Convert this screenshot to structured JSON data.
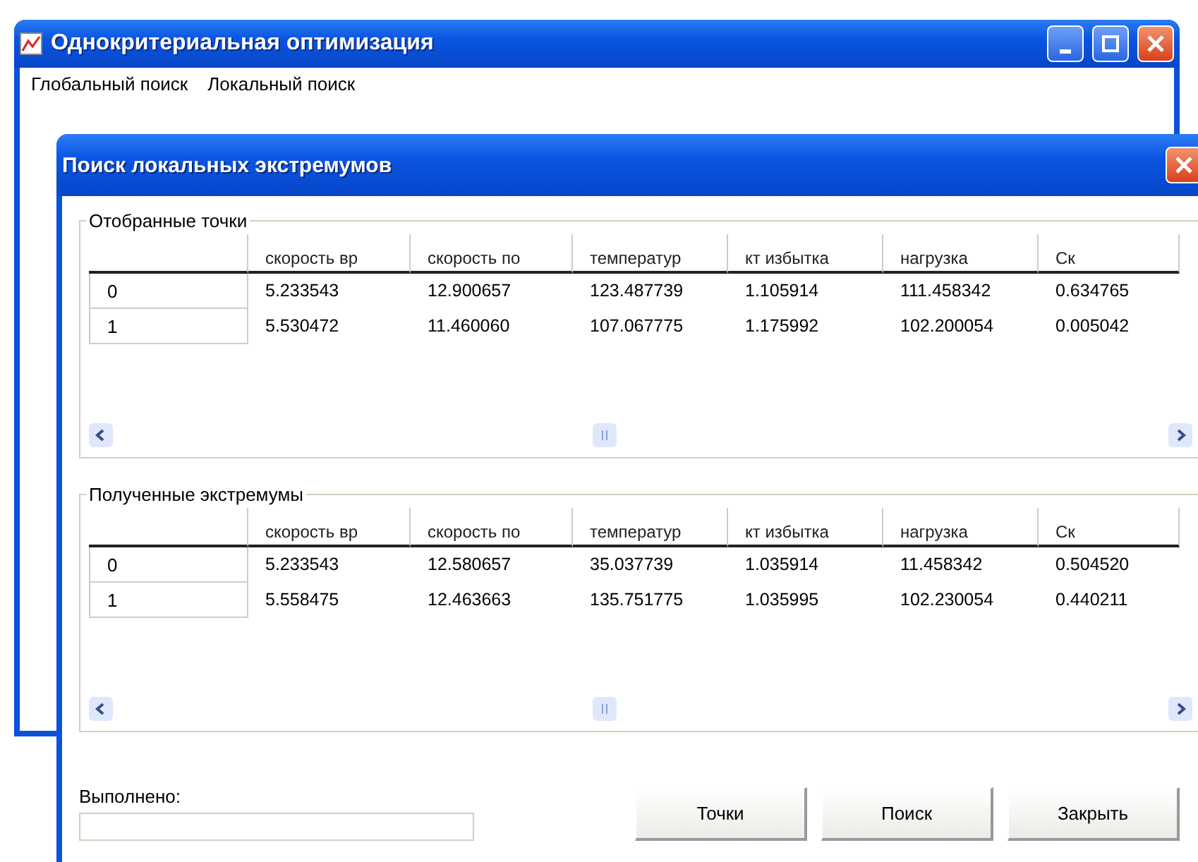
{
  "main_window": {
    "title": "Однокритериальная оптимизация",
    "menu": [
      "Глобальный поиск",
      "Локальный поиск"
    ]
  },
  "dialog": {
    "title": "Поиск локальных экстремумов",
    "groups": [
      {
        "title": "Отобранные точки",
        "columns": [
          "скорость вр",
          "скорость по",
          "температур",
          "кт избытка",
          "нагрузка",
          "Ск"
        ],
        "rows": [
          {
            "label": "0",
            "cells": [
              "5.233543",
              "12.900657",
              "123.487739",
              "1.105914",
              "111.458342",
              "0.634765"
            ]
          },
          {
            "label": "1",
            "cells": [
              "5.530472",
              "11.460060",
              "107.067775",
              "1.175992",
              "102.200054",
              "0.005042"
            ]
          }
        ]
      },
      {
        "title": "Полученные экстремумы",
        "columns": [
          "скорость вр",
          "скорость по",
          "температур",
          "кт избытка",
          "нагрузка",
          "Ск"
        ],
        "rows": [
          {
            "label": "0",
            "cells": [
              "5.233543",
              "12.580657",
              "35.037739",
              "1.035914",
              "11.458342",
              "0.504520"
            ]
          },
          {
            "label": "1",
            "cells": [
              "5.558475",
              "12.463663",
              "135.751775",
              "1.035995",
              "102.230054",
              "0.440211"
            ]
          }
        ]
      }
    ],
    "progress": {
      "label": "Выполнено:"
    },
    "buttons": [
      "Точки",
      "Поиск",
      "Закрыть"
    ]
  }
}
